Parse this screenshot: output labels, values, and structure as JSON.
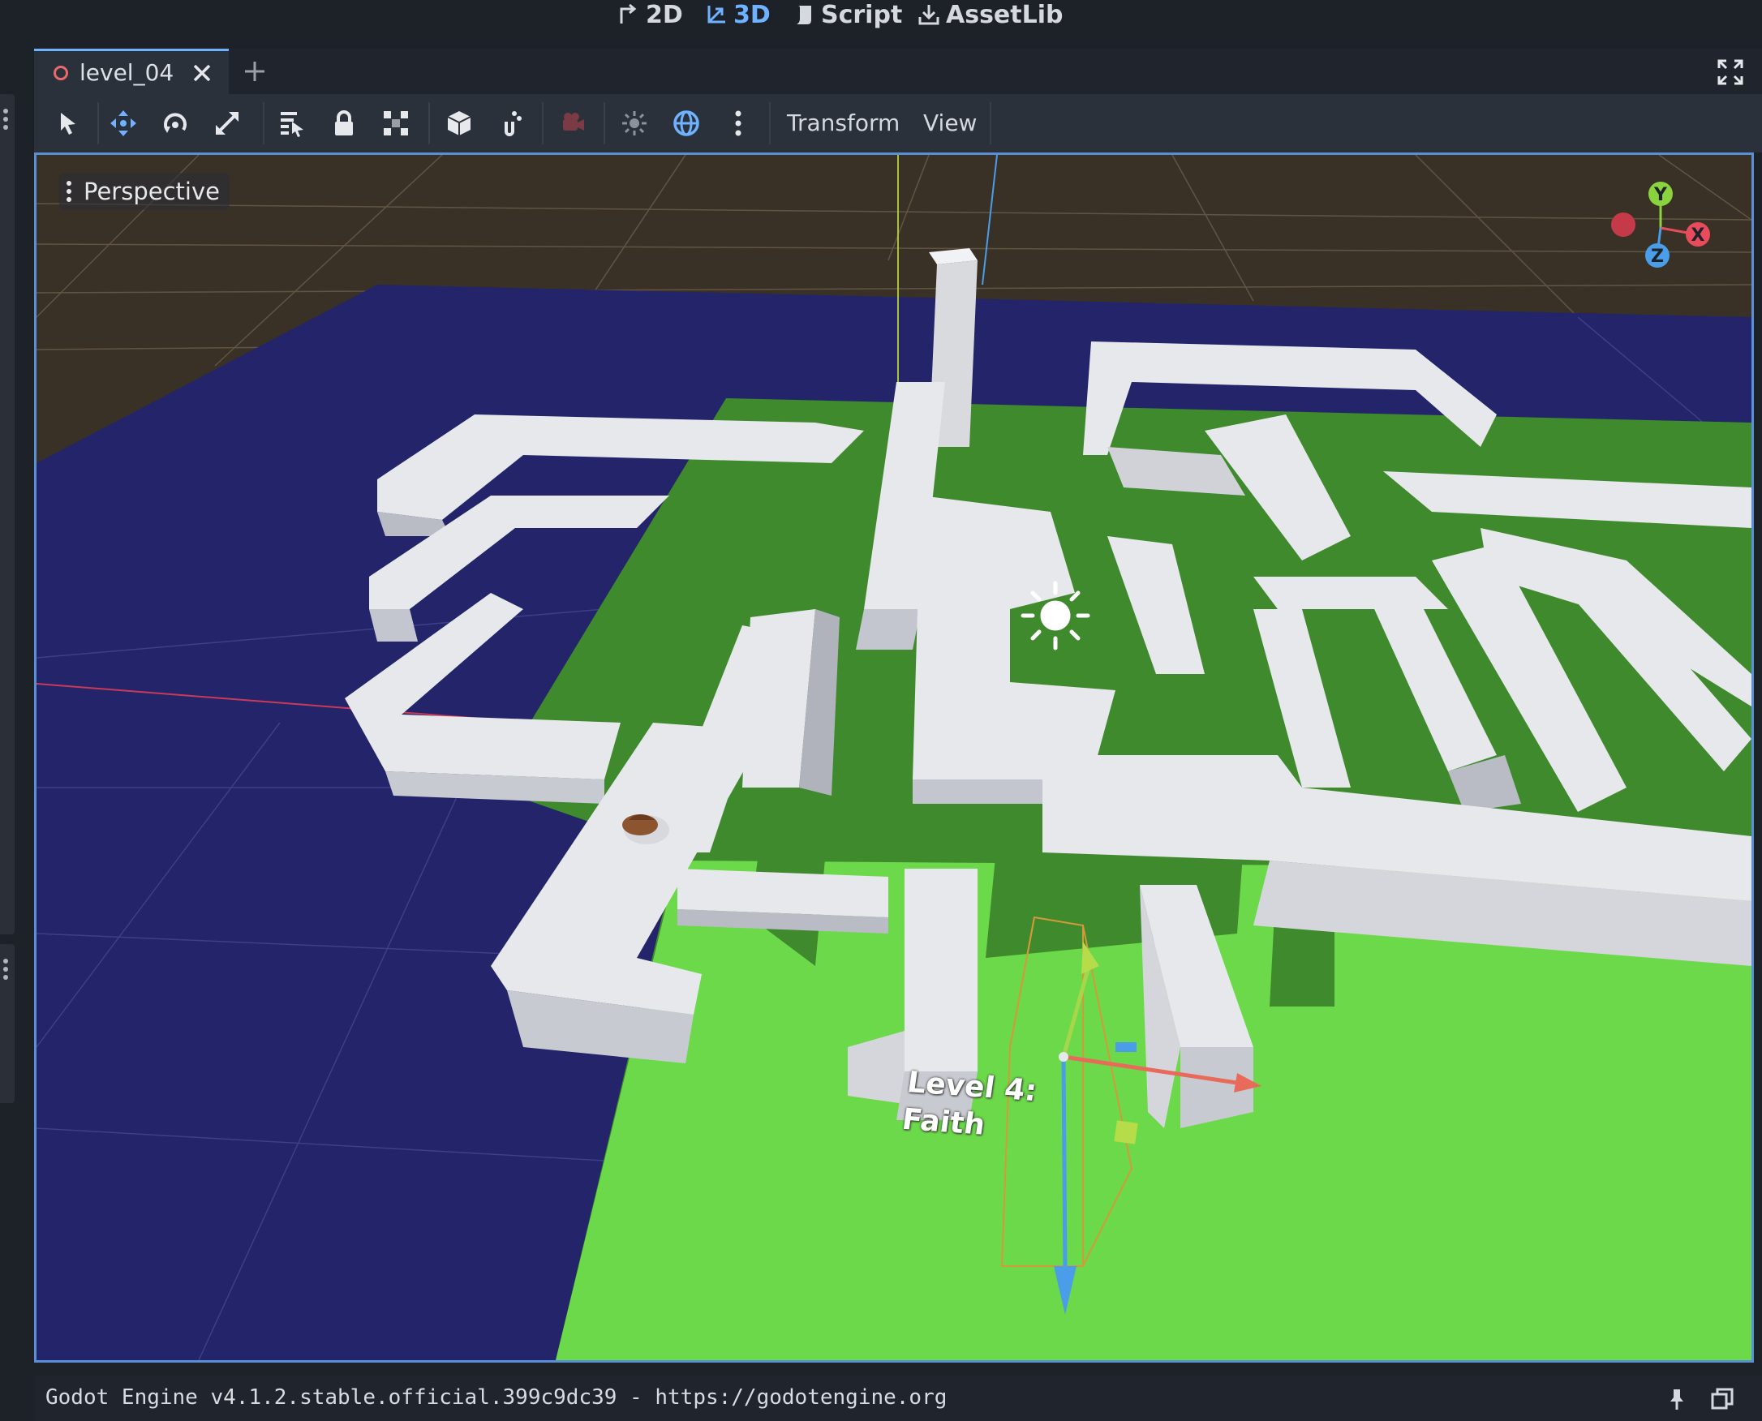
{
  "workspaces": {
    "btn_2d": "2D",
    "btn_3d": "3D",
    "btn_script": "Script",
    "btn_assetlib": "AssetLib",
    "active": "3D",
    "accent_color": "#6fb2ff"
  },
  "scene_tabs": {
    "tabs": [
      {
        "label": "level_04",
        "status_icon": "scene-unsaved-circle-icon",
        "status_color": "#e86a6a"
      }
    ],
    "add_tab_icon": "plus-icon",
    "distraction_free_icon": "expand-icon"
  },
  "toolbar": {
    "tools": [
      "select-tool-icon",
      "move-tool-icon",
      "rotate-tool-icon",
      "scale-tool-icon",
      "list-select-icon",
      "lock-icon",
      "group-icon",
      "use-local-space-icon",
      "snap-icon",
      "preview-camera-icon",
      "sun-preview-icon",
      "environment-preview-icon",
      "more-options-icon"
    ],
    "transform_menu": "Transform",
    "view_menu": "View"
  },
  "viewport": {
    "view_mode": "Perspective",
    "gizmo_axes": {
      "y": "Y",
      "x": "X",
      "z": "Z"
    },
    "axis_colors": {
      "x": "#e84c5c",
      "y": "#8bd33e",
      "z": "#4a9de8"
    },
    "world_label_line1": "Level 4:",
    "world_label_line2": "Faith",
    "colors": {
      "sky_ground": "#3a3126",
      "floor": "#232469",
      "grass": "#6cd94a",
      "grass_shadow": "#3e8a2c",
      "walls": "#e4e5e9"
    }
  },
  "output": {
    "version_text": "Godot Engine v4.1.2.stable.official.399c9dc39 - https://godotengine.org",
    "pin_icon": "pin-icon",
    "window_icon": "make-floating-icon"
  }
}
